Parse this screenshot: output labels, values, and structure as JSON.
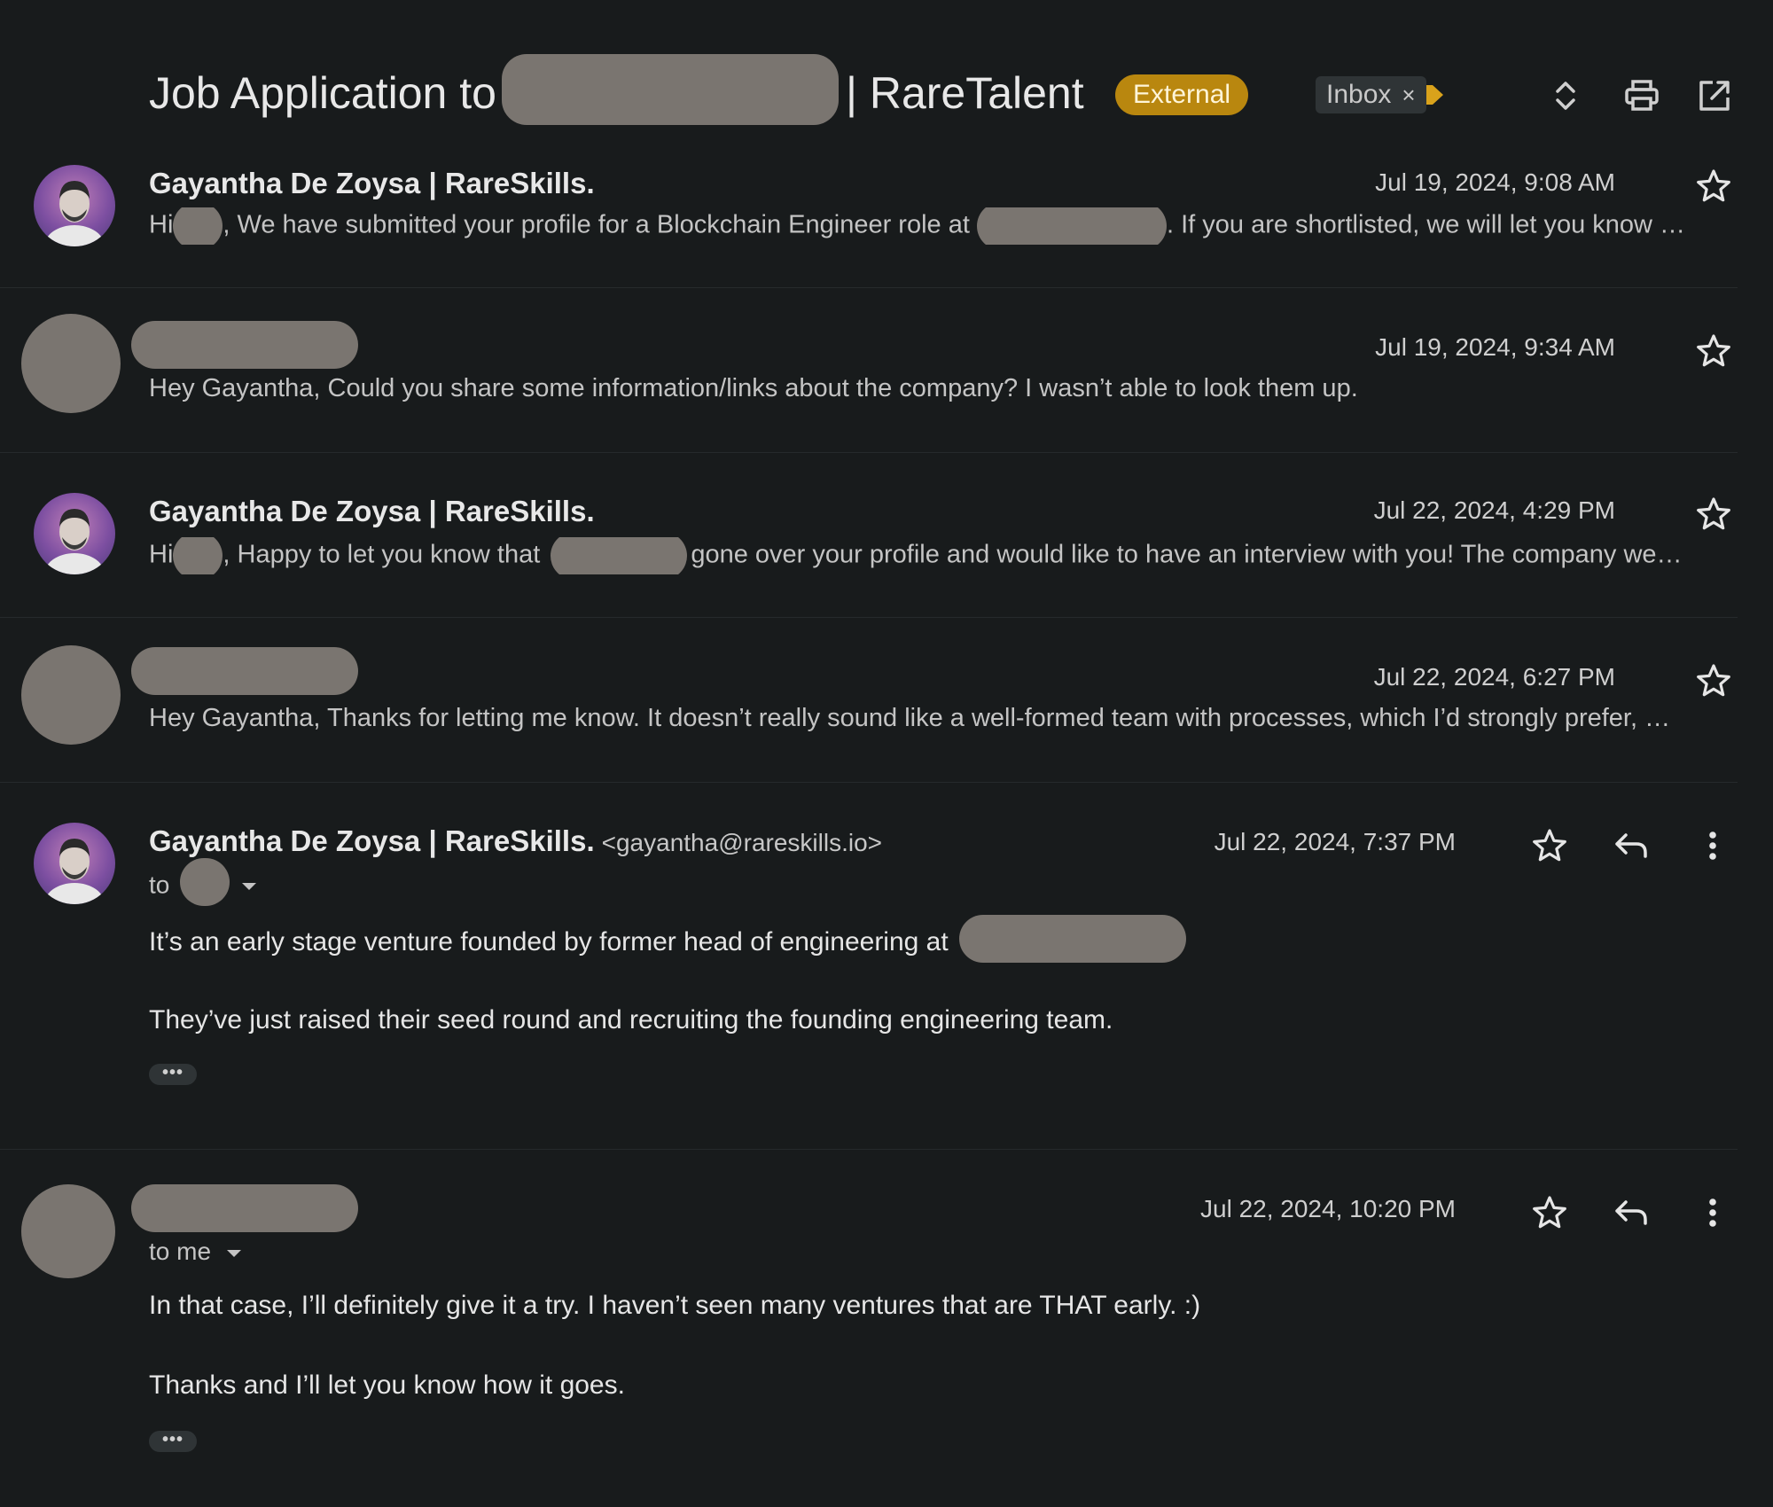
{
  "header": {
    "subject_prefix": "Job Application to",
    "subject_suffix": "| RareTalent",
    "external_label": "External",
    "inbox_label": "Inbox",
    "inbox_close": "×",
    "icons": [
      "expand-collapse-icon",
      "print-icon",
      "open-in-new-window-icon"
    ]
  },
  "messages": [
    {
      "sender": "Gayantha De Zoysa | RareSkills.",
      "date": "Jul 19, 2024, 9:08 AM",
      "snippet_a": "Hi",
      "snippet_b": ", We have submitted your profile for a Blockchain Engineer role at",
      "snippet_c": ". If you are shortlisted, we will let you know …"
    },
    {
      "date": "Jul 19, 2024, 9:34 AM",
      "snippet": "Hey Gayantha, Could you share some information/links about the company? I wasn’t able to look them up."
    },
    {
      "sender": "Gayantha De Zoysa | RareSkills.",
      "date": "Jul 22, 2024, 4:29 PM",
      "snippet_a": "Hi",
      "snippet_b": ", Happy to let you know that",
      "snippet_c": "gone over your profile and would like to have an interview with you! The company we…"
    },
    {
      "date": "Jul 22, 2024, 6:27 PM",
      "snippet": "Hey Gayantha, Thanks for letting me know. It doesn’t really sound like a well-formed team with processes, which I’d strongly prefer, …"
    },
    {
      "sender": "Gayantha De Zoysa | RareSkills.",
      "sender_email": "<gayantha@rareskills.io>",
      "date": "Jul 22, 2024, 7:37 PM",
      "to_label": "to",
      "body_line1": "It’s an early stage venture founded by former head of engineering at",
      "body_line2": "They’ve just raised their seed round and recruiting the founding engineering team.",
      "dots": "•••"
    },
    {
      "date": "Jul 22, 2024, 10:20 PM",
      "to_label": "to me",
      "body_line1": "In that case, I’ll definitely give it a try. I haven’t seen many ventures that are THAT early. :)",
      "body_line2": "Thanks and I’ll let you know how it goes.",
      "dots": "•••"
    }
  ],
  "colors": {
    "background": "#181b1c",
    "external_badge": "#b9870f",
    "importance_marker": "#d9a21b",
    "redaction": "#7a7570"
  }
}
